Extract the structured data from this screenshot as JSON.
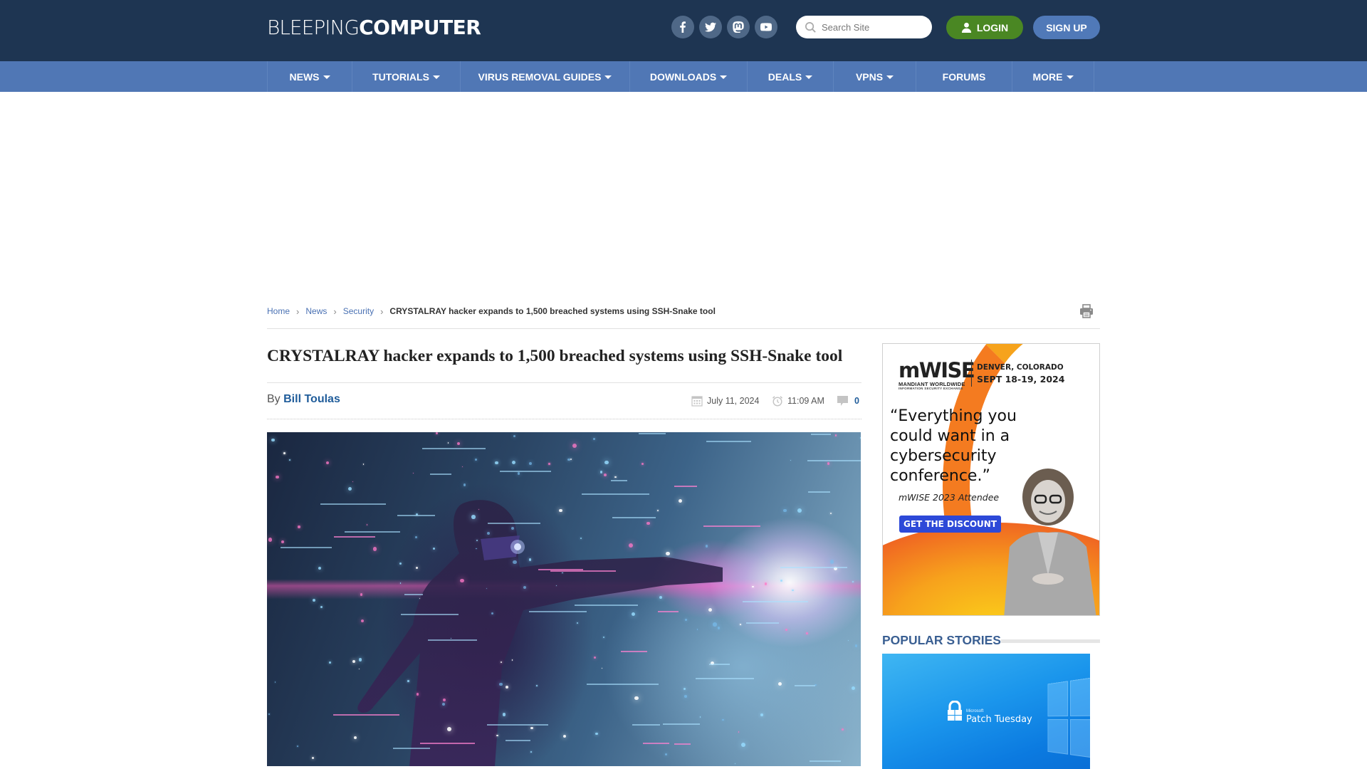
{
  "header": {
    "logo_light": "BLEEPING",
    "logo_bold": "COMPUTER",
    "social": [
      {
        "name": "facebook",
        "icon": "facebook-icon"
      },
      {
        "name": "twitter",
        "icon": "twitter-icon"
      },
      {
        "name": "mastodon",
        "icon": "mastodon-icon"
      },
      {
        "name": "youtube",
        "icon": "youtube-icon"
      }
    ],
    "search_placeholder": "Search Site",
    "search_value": "",
    "login_label": "LOGIN",
    "signup_label": "SIGN UP"
  },
  "nav": {
    "items": [
      {
        "label": "NEWS",
        "dropdown": true
      },
      {
        "label": "TUTORIALS",
        "dropdown": true
      },
      {
        "label": "VIRUS REMOVAL GUIDES",
        "dropdown": true
      },
      {
        "label": "DOWNLOADS",
        "dropdown": true
      },
      {
        "label": "DEALS",
        "dropdown": true
      },
      {
        "label": "VPNS",
        "dropdown": true
      },
      {
        "label": "FORUMS",
        "dropdown": false
      },
      {
        "label": "MORE",
        "dropdown": true
      }
    ]
  },
  "breadcrumb": {
    "items": [
      "Home",
      "News",
      "Security"
    ],
    "current": "CRYSTALRAY hacker expands to 1,500 breached systems using SSH-Snake tool"
  },
  "article": {
    "title": "CRYSTALRAY hacker expands to 1,500 breached systems using SSH-Snake tool",
    "by_label": "By",
    "author": "Bill Toulas",
    "date": "July 11, 2024",
    "time": "11:09 AM",
    "comments": "0"
  },
  "ad": {
    "brand": "mWISE",
    "brand_sub1": "MANDIANT WORLDWIDE",
    "brand_sub2": "INFORMATION SECURITY EXCHANGE",
    "location": "DENVER, COLORADO",
    "dates": "SEPT 18-19, 2024",
    "quote": "“Everything you could want in a cybersecurity conference.”",
    "attribution": "mWISE 2023 Attendee",
    "cta": "GET THE DISCOUNT"
  },
  "sidebar": {
    "popular_title": "POPULAR STORIES",
    "popular_image_small": "Microsoft",
    "popular_image_caption": "Patch Tuesday"
  },
  "colors": {
    "header_bg": "#1e3552",
    "nav_bg": "#5077b5",
    "login_green": "#4a8723",
    "signup_blue": "#5079b8",
    "link_blue": "#4a71b3",
    "author_blue": "#1f5c9a",
    "section_title": "#3a5f92"
  }
}
